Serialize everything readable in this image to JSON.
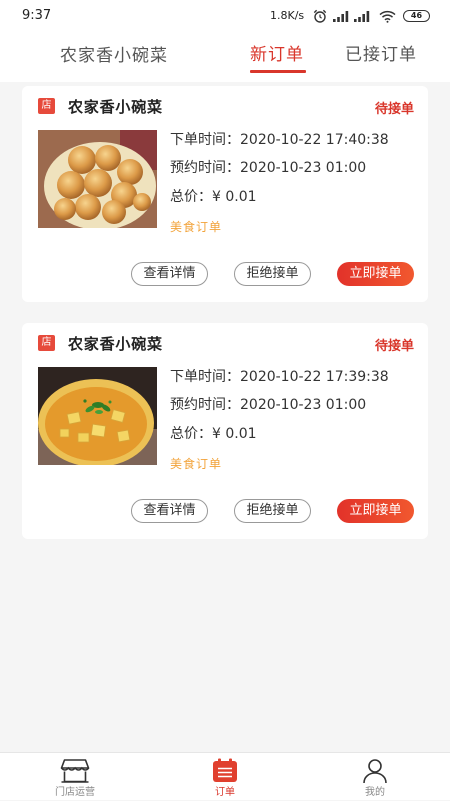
{
  "status_bar": {
    "time": "9:37",
    "speed": "1.8K/s",
    "battery": "46",
    "icons": [
      "alarm-icon",
      "signal-icon",
      "signal-icon",
      "wifi-icon",
      "battery-icon"
    ]
  },
  "header": {
    "store_name": "农家香小碗菜",
    "tabs": [
      {
        "label": "新订单",
        "active": true
      },
      {
        "label": "已接订单",
        "active": false
      }
    ]
  },
  "orders": [
    {
      "store_badge": "店",
      "store_name": "农家香小碗菜",
      "status": "待接单",
      "order_time_label": "下单时间：",
      "order_time": "2020-10-22 17:40:38",
      "reserve_time_label": "预约时间：",
      "reserve_time": "2020-10-23 01:00",
      "total_label": "总价：",
      "total": "¥ 0.01",
      "category": "美食订单",
      "actions": {
        "detail": "查看详情",
        "reject": "拒绝接单",
        "accept": "立即接单"
      }
    },
    {
      "store_badge": "店",
      "store_name": "农家香小碗菜",
      "status": "待接单",
      "order_time_label": "下单时间：",
      "order_time": "2020-10-22 17:39:38",
      "reserve_time_label": "预约时间：",
      "reserve_time": "2020-10-23 01:00",
      "total_label": "总价：",
      "total": "¥ 0.01",
      "category": "美食订单",
      "actions": {
        "detail": "查看详情",
        "reject": "拒绝接单",
        "accept": "立即接单"
      }
    }
  ],
  "bottom_nav": [
    {
      "label": "门店运营",
      "icon": "store-icon",
      "active": false
    },
    {
      "label": "订单",
      "icon": "order-list-icon",
      "active": true
    },
    {
      "label": "我的",
      "icon": "person-icon",
      "active": false
    }
  ],
  "colors": {
    "accent": "#d9362b",
    "tag": "#f2a33a",
    "background": "#f5f5f5"
  }
}
